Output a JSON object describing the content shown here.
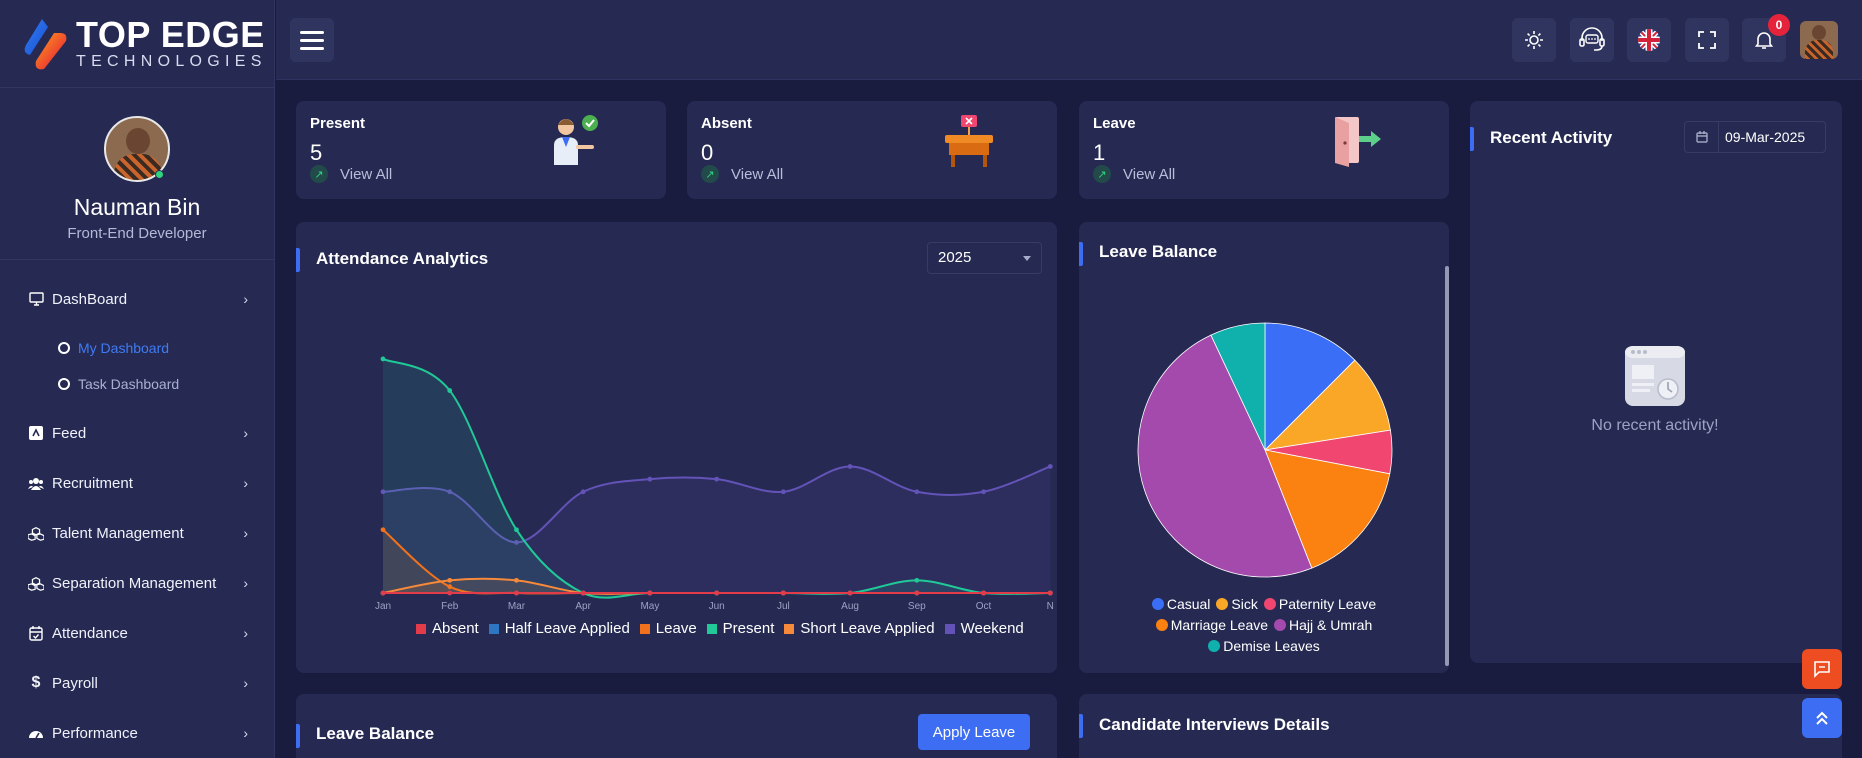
{
  "brand": {
    "title": "TOP EDGE",
    "subtitle": "TECHNOLOGIES"
  },
  "profile": {
    "name": "Nauman Bin",
    "role": "Front-End Developer"
  },
  "sidebar": {
    "items": [
      {
        "label": "DashBoard",
        "icon": "monitor-icon"
      },
      {
        "label": "Feed",
        "icon": "feed-icon"
      },
      {
        "label": "Recruitment",
        "icon": "users-icon"
      },
      {
        "label": "Talent Management",
        "icon": "cubes-icon"
      },
      {
        "label": "Separation Management",
        "icon": "cubes-icon"
      },
      {
        "label": "Attendance",
        "icon": "calendar-check-icon"
      },
      {
        "label": "Payroll",
        "icon": "dollar-icon"
      },
      {
        "label": "Performance",
        "icon": "gauge-icon"
      }
    ],
    "subitems": [
      {
        "label": "My Dashboard",
        "active": true
      },
      {
        "label": "Task Dashboard",
        "active": false
      }
    ]
  },
  "topbar": {
    "notifications_count": "0"
  },
  "stats": [
    {
      "label": "Present",
      "value": "5",
      "link": "View All"
    },
    {
      "label": "Absent",
      "value": "0",
      "link": "View All"
    },
    {
      "label": "Leave",
      "value": "1",
      "link": "View All"
    }
  ],
  "attendance": {
    "title": "Attendance Analytics",
    "year": "2025"
  },
  "chart_data": [
    {
      "type": "area",
      "title": "Attendance Analytics",
      "categories": [
        "Jan",
        "Feb",
        "Mar",
        "Apr",
        "May",
        "Jun",
        "Jul",
        "Aug",
        "Sep",
        "Oct",
        "N"
      ],
      "series": [
        {
          "name": "Absent",
          "color": "#e23c4a",
          "values": [
            0,
            0,
            0,
            0,
            0,
            0,
            0,
            0,
            0,
            0,
            0
          ]
        },
        {
          "name": "Half Leave Applied",
          "color": "#2f76c2",
          "values": [
            0,
            0,
            0,
            0,
            0,
            0,
            0,
            0,
            0,
            0,
            0
          ]
        },
        {
          "name": "Leave",
          "color": "#f2711c",
          "values": [
            1,
            0.1,
            0,
            0,
            0,
            0,
            0,
            0,
            0,
            0,
            0
          ]
        },
        {
          "name": "Present",
          "color": "#20c997",
          "values": [
            3.7,
            3.2,
            1,
            0,
            0,
            0,
            0,
            0,
            0.2,
            0,
            0
          ]
        },
        {
          "name": "Short Leave Applied",
          "color": "#f7893b",
          "values": [
            0,
            0.2,
            0.2,
            0,
            0,
            0,
            0,
            0,
            0,
            0,
            0
          ]
        },
        {
          "name": "Weekend",
          "color": "#6353b8",
          "values": [
            1.6,
            1.6,
            0.8,
            1.6,
            1.8,
            1.8,
            1.6,
            2,
            1.6,
            1.6,
            2
          ]
        }
      ]
    },
    {
      "type": "pie",
      "title": "Leave Balance",
      "categories": [
        "Casual",
        "Sick",
        "Paternity Leave",
        "Marriage Leave",
        "Hajj & Umrah",
        "Demise Leaves"
      ],
      "colors": [
        "#3b6ef6",
        "#faa627",
        "#f0466f",
        "#fb8110",
        "#a54aad",
        "#10b0ad"
      ],
      "values": [
        12.5,
        10,
        5.5,
        16,
        49,
        7
      ]
    }
  ],
  "leave_balance": {
    "title": "Leave Balance"
  },
  "recent_activity": {
    "title": "Recent Activity",
    "date": "09-Mar-2025",
    "empty_text": "No recent activity!"
  },
  "bottom": {
    "leave_title": "Leave Balance",
    "apply_label": "Apply Leave",
    "interviews_title": "Candidate Interviews Details"
  }
}
